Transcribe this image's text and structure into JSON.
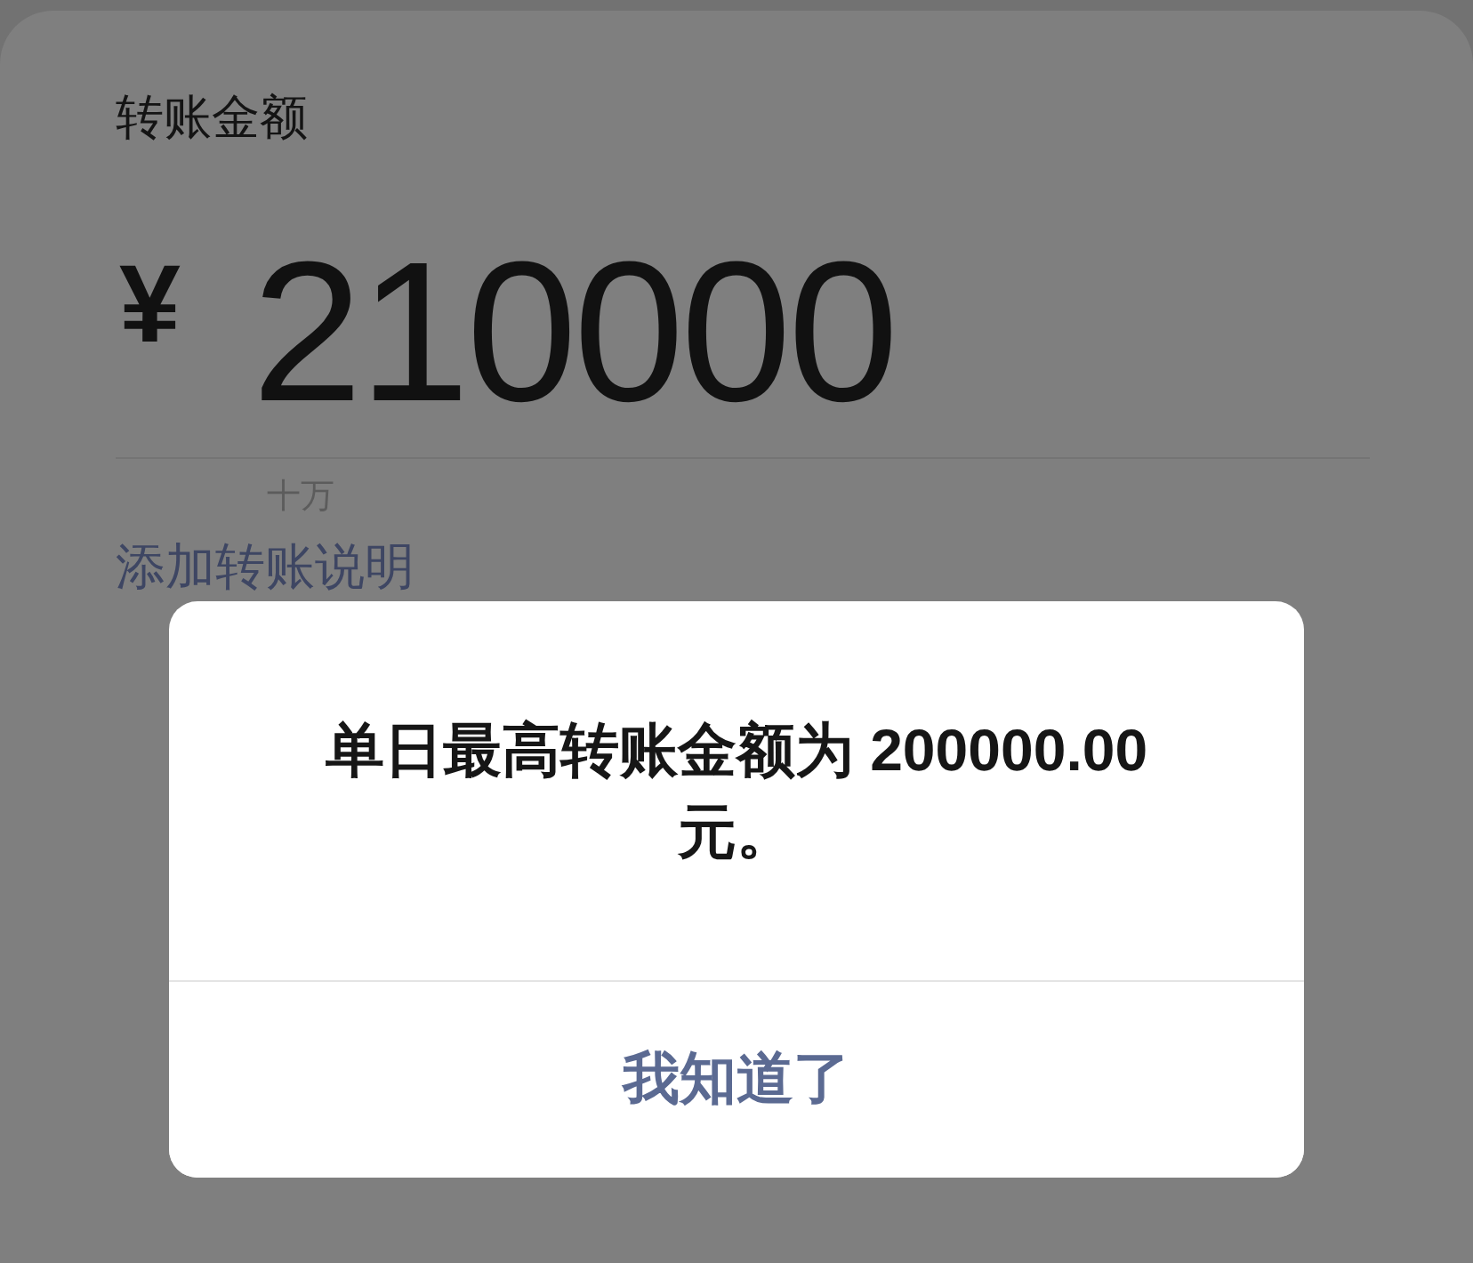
{
  "transfer_form": {
    "amount_label": "转账金额",
    "currency_symbol": "¥",
    "amount": "210000",
    "amount_unit_hint": "十万",
    "add_note_link": "添加转账说明"
  },
  "dialog": {
    "message": "单日最高转账金额为 200000.00 元。",
    "buttons": [
      "我知道了"
    ]
  }
}
